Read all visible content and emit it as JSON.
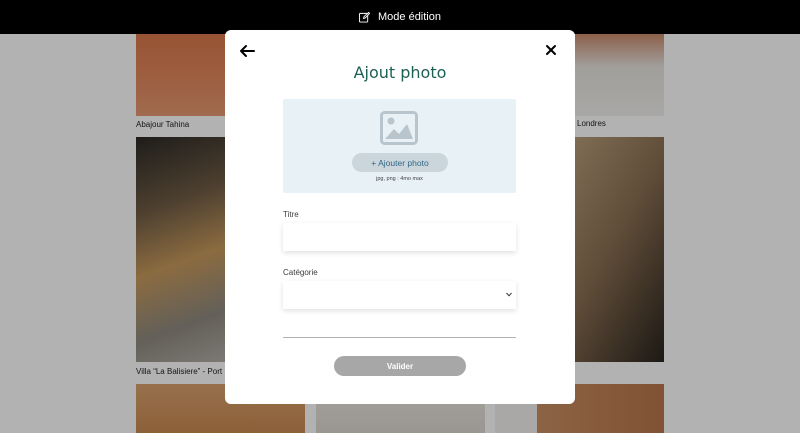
{
  "topbar": {
    "edit_mode_label": "Mode édition",
    "icon": "edit-icon"
  },
  "gallery": {
    "captions": {
      "abajour": "Abajour Tahina",
      "londres": "Londres",
      "villa": "Villa “La Balisiere” - Port"
    }
  },
  "modal": {
    "back_icon": "arrow-left-icon",
    "close_icon": "close-icon",
    "title": "Ajout photo",
    "upload": {
      "icon": "image-icon",
      "add_button_label": "+ Ajouter photo",
      "format_hint": "jpg, png : 4mo max"
    },
    "fields": {
      "title_label": "Titre",
      "title_value": "",
      "category_label": "Catégorie",
      "category_value": ""
    },
    "submit_label": "Valider"
  },
  "colors": {
    "title_green": "#1d6154",
    "upload_bg": "#e8f1f6",
    "button_disabled": "#a7a7a7",
    "add_button_text": "#306685"
  }
}
